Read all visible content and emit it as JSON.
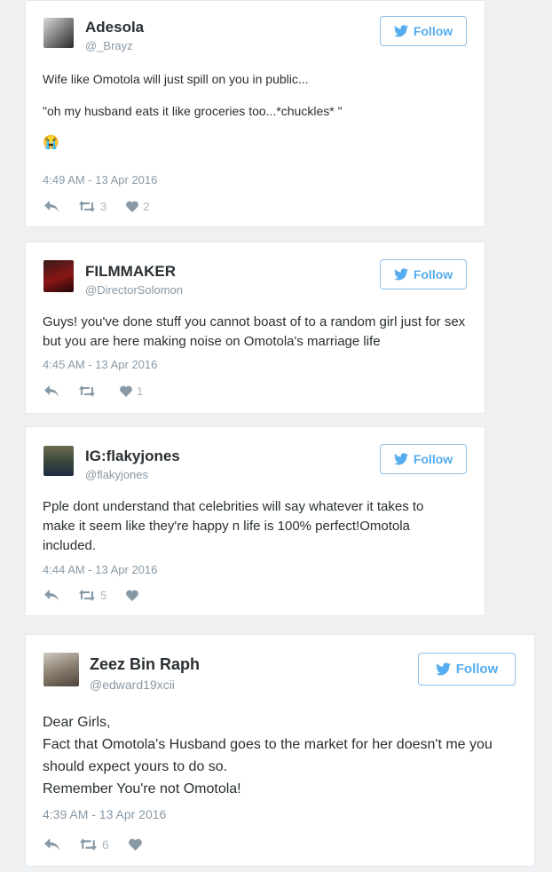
{
  "colors": {
    "twitter_blue": "#55acee",
    "meta_gray": "#8899a6",
    "action_gray": "#aab8c2"
  },
  "icons": {
    "follow": "bird-icon",
    "reply": "reply-icon",
    "retweet": "retweet-icon",
    "like": "heart-icon",
    "emoji": "crying-face-emoji-icon"
  },
  "tweets": [
    {
      "name": "Adesola",
      "handle": "@_Brayz",
      "follow_label": "Follow",
      "lines": [
        "Wife like Omotola will just spill on you in public...",
        "",
        "\"oh my husband eats it like groceries too...*chuckles* \"",
        "",
        "😭"
      ],
      "time": "4:49 AM - 13 Apr 2016",
      "retweets": "3",
      "likes": "2"
    },
    {
      "name": "FILMMAKER",
      "handle": "@DirectorSolomon",
      "follow_label": "Follow",
      "lines": [
        "Guys! you've done stuff you cannot boast of to a random girl just for sex but you are here making noise on Omotola's marriage life"
      ],
      "time": "4:45 AM - 13 Apr 2016",
      "retweets": "",
      "likes": "1"
    },
    {
      "name": "IG:flakyjones",
      "handle": "@flakyjones",
      "follow_label": "Follow",
      "lines": [
        "Pple dont understand that celebrities will say whatever it takes to make it seem like they're happy n life is 100% perfect!Omotola included."
      ],
      "time": "4:44 AM - 13 Apr 2016",
      "retweets": "5",
      "likes": ""
    },
    {
      "name": "Zeez Bin Raph",
      "handle": "@edward19xcii",
      "follow_label": "Follow",
      "lines": [
        "Dear Girls,",
        "Fact that Omotola's Husband goes to the market for her doesn't me you should expect yours to do so.",
        "Remember You're not Omotola!"
      ],
      "time": "4:39 AM - 13 Apr 2016",
      "retweets": "6",
      "likes": ""
    }
  ]
}
